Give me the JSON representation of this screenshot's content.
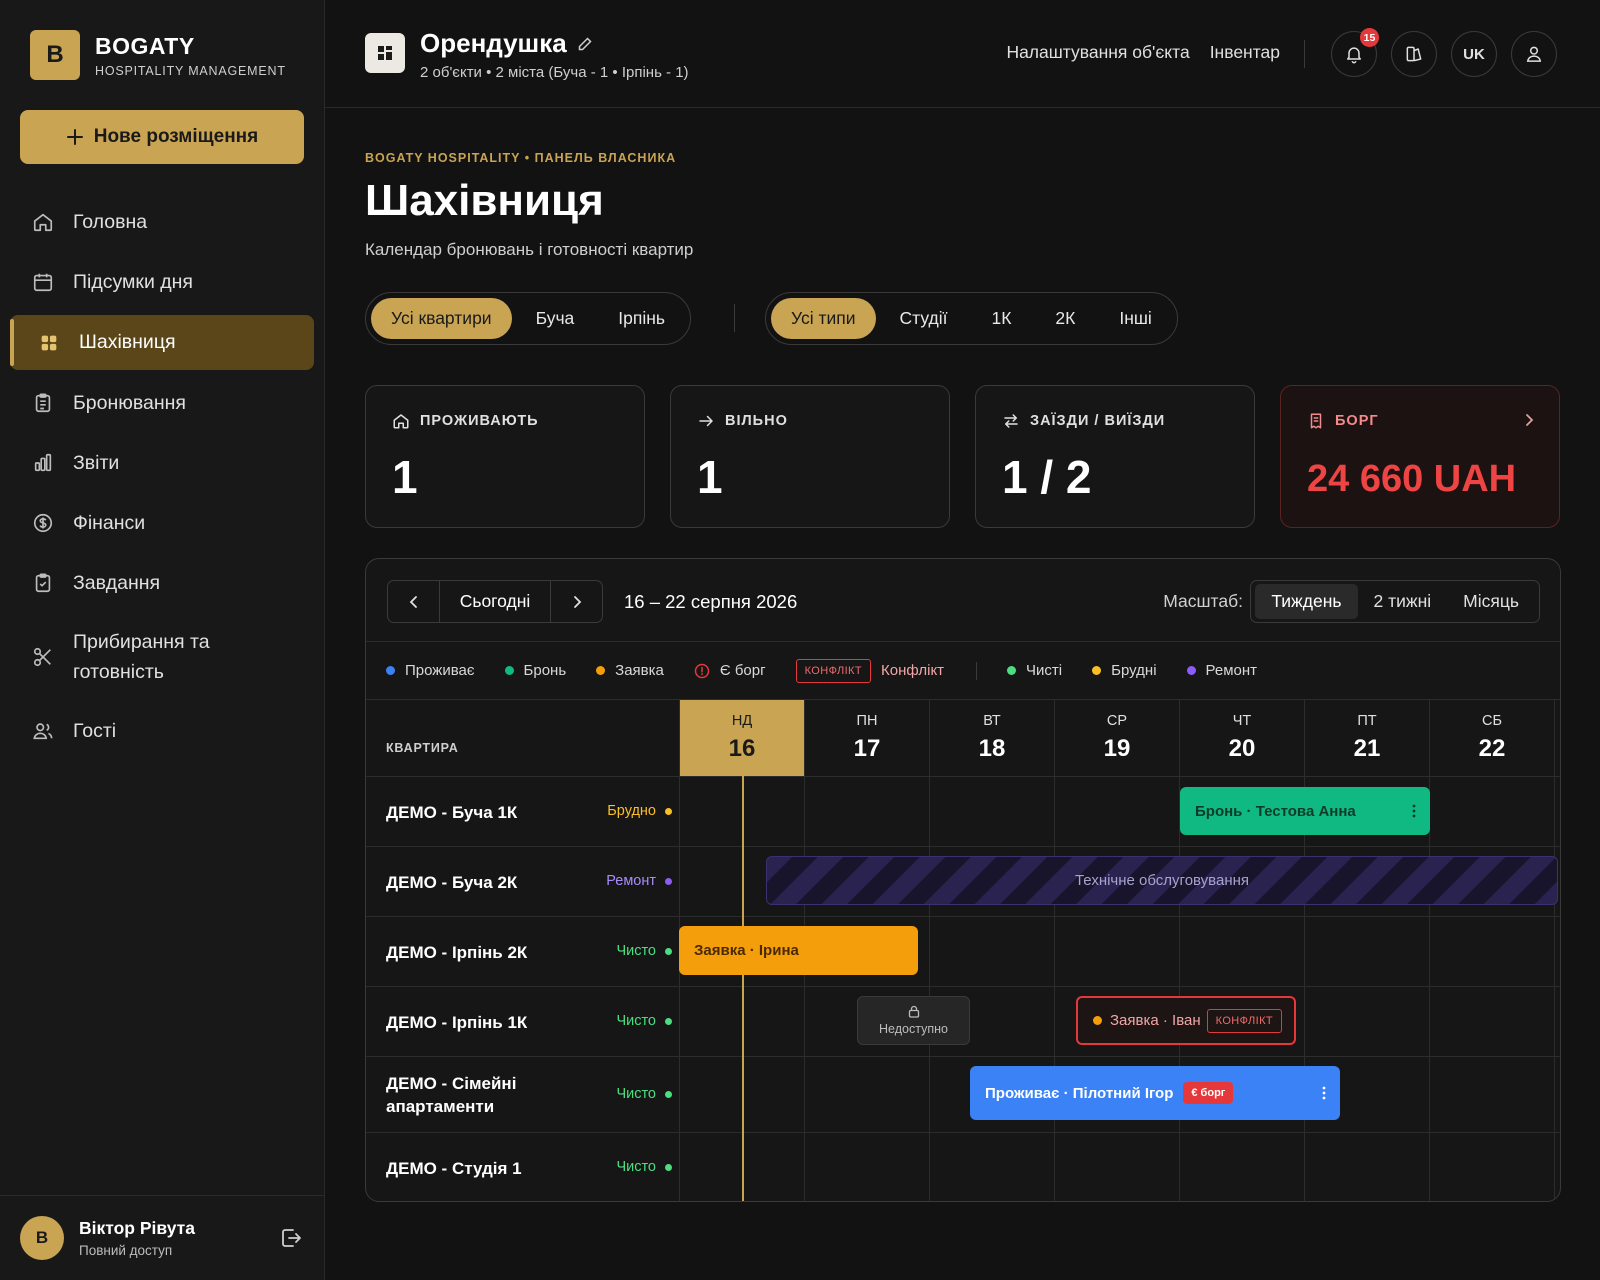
{
  "brand": {
    "logo_letter": "B",
    "name": "BOGATY",
    "subtitle": "HOSPITALITY MANAGEMENT"
  },
  "new_button": {
    "label": "Нове розміщення"
  },
  "nav": [
    {
      "label": "Головна",
      "icon": "home-icon"
    },
    {
      "label": "Підсумки дня",
      "icon": "calendar-icon"
    },
    {
      "label": "Шахівниця",
      "icon": "grid-icon",
      "active": true
    },
    {
      "label": "Бронювання",
      "icon": "clipboard-icon"
    },
    {
      "label": "Звіти",
      "icon": "bar-chart-icon"
    },
    {
      "label": "Фінанси",
      "icon": "dollar-circle-icon"
    },
    {
      "label": "Завдання",
      "icon": "clipboard-check-icon"
    },
    {
      "label": "Прибирання та готовність",
      "icon": "scissors-icon"
    },
    {
      "label": "Гості",
      "icon": "users-icon"
    }
  ],
  "user": {
    "initial": "B",
    "name": "Віктор Рівута",
    "role": "Повний доступ"
  },
  "topbar": {
    "title": "Орендушка",
    "subtitle": "2 об'єкти • 2 міста (Буча - 1 • Ірпінь - 1)",
    "links": [
      "Налаштування об'єкта",
      "Інвентар"
    ],
    "notifications": "15",
    "lang": "UK"
  },
  "page": {
    "eyebrow": "BOGATY HOSPITALITY • ПАНЕЛЬ ВЛАСНИКА",
    "title": "Шахівниця",
    "subtitle": "Календар бронювань і готовності квартир"
  },
  "filters": {
    "locations": [
      "Усі квартири",
      "Буча",
      "Ірпінь"
    ],
    "types": [
      "Усі типи",
      "Студії",
      "1К",
      "2К",
      "Інші"
    ]
  },
  "stats": [
    {
      "label": "ПРОЖИВАЮТЬ",
      "value": "1",
      "icon": "home-icon"
    },
    {
      "label": "ВІЛЬНО",
      "value": "1",
      "icon": "arrow-right-icon"
    },
    {
      "label": "ЗАЇЗДИ / ВИЇЗДИ",
      "value": "1 / 2",
      "icon": "swap-icon"
    },
    {
      "label": "БОРГ",
      "value": "24 660 UAH",
      "icon": "receipt-icon"
    }
  ],
  "calendar": {
    "today_label": "Сьогодні",
    "range": "16 – 22 серпня 2026",
    "scale_label": "Масштаб:",
    "scales": [
      "Тиждень",
      "2 тижні",
      "Місяць"
    ],
    "legend": {
      "living": "Проживає",
      "booking": "Бронь",
      "request": "Заявка",
      "debt": "Є борг",
      "conflict_tag": "КОНФЛІКТ",
      "conflict": "Конфлікт",
      "clean": "Чисті",
      "dirty": "Брудні",
      "repair": "Ремонт"
    },
    "colors": {
      "living": "#3b82f6",
      "booking": "#10b981",
      "request": "#f59e0b",
      "debt": "#e5383b",
      "clean": "#4ade80",
      "dirty": "#fbbf24",
      "repair": "#8b5cf6"
    },
    "column_header": "КВАРТИРА",
    "days": [
      {
        "dow": "НД",
        "num": "16",
        "today": true
      },
      {
        "dow": "ПН",
        "num": "17"
      },
      {
        "dow": "ВТ",
        "num": "18"
      },
      {
        "dow": "СР",
        "num": "19"
      },
      {
        "dow": "ЧТ",
        "num": "20"
      },
      {
        "dow": "ПТ",
        "num": "21"
      },
      {
        "dow": "СБ",
        "num": "22"
      }
    ],
    "rows": [
      {
        "name": "ДЕМО - Буча 1К",
        "status": "Брудно",
        "status_color": "#fbbf24"
      },
      {
        "name": "ДЕМО - Буча 2К",
        "status": "Ремонт",
        "status_color": "#8b5cf6"
      },
      {
        "name": "ДЕМО - Ірпінь 2К",
        "status": "Чисто",
        "status_color": "#4ade80"
      },
      {
        "name": "ДЕМО - Ірпінь 1К",
        "status": "Чисто",
        "status_color": "#4ade80"
      },
      {
        "name": "ДЕМО - Сімейні апартаменти",
        "status": "Чисто",
        "status_color": "#4ade80"
      },
      {
        "name": "ДЕМО - Студія 1",
        "status": "Чисто",
        "status_color": "#4ade80"
      }
    ],
    "bookings": {
      "b1": "Бронь · Тестова Анна",
      "maintenance": "Технічне обслуговування",
      "b2": "Заявка · Ірина",
      "unavailable": "Недоступно",
      "b3": "Заявка · Іван",
      "b3_tag": "КОНФЛІКТ",
      "b4": "Проживає · Пілотний Ігор",
      "b4_badge": "€ борг"
    }
  }
}
